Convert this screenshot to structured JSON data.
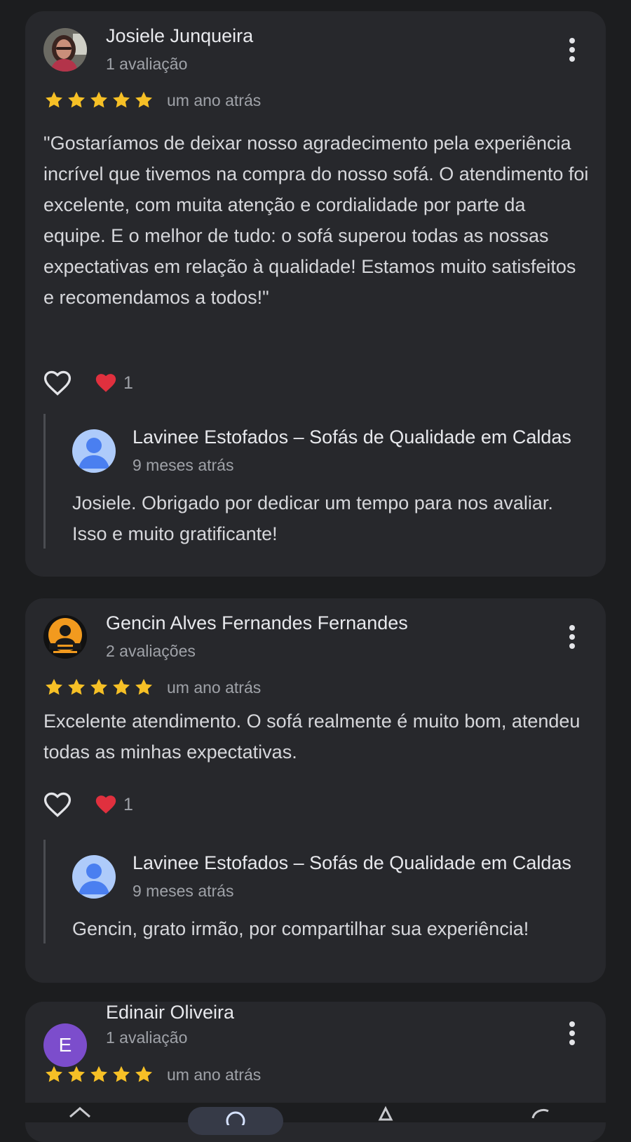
{
  "reviews": [
    {
      "author": "Josiele Junqueira",
      "author_meta": "1 avaliação",
      "rating": 5,
      "time": "um ano atrás",
      "text": "\"Gostaríamos de deixar nosso agradecimento pela experiência incrível que tivemos na compra do nosso sofá. O atendimento foi excelente, com muita atenção e cordialidade por parte da equipe. E o melhor de tudo: o sofá superou todas as nossas expectativas em relação à qualidade! Estamos muito satisfeitos e recomendamos a todos!\"",
      "reactions": "1",
      "reply": {
        "name": "Lavinee Estofados – Sofás de Qualidade em Caldas",
        "time": "9 meses atrás",
        "text": "Josiele. Obrigado por dedicar um tempo para nos avaliar. Isso e muito gratificante!"
      }
    },
    {
      "author": "Gencin Alves Fernandes Fernandes",
      "author_meta": "2 avaliações",
      "rating": 5,
      "time": "um ano atrás",
      "text": "Excelente atendimento. O sofá realmente é muito bom, atendeu todas as minhas expectativas.",
      "reactions": "1",
      "reply": {
        "name": "Lavinee Estofados – Sofás de Qualidade em Caldas",
        "time": "9 meses atrás",
        "text": "Gencin, grato irmão, por compartilhar sua experiência!"
      }
    },
    {
      "author": "Edinair Oliveira",
      "author_meta": "1 avaliação",
      "avatar_letter": "E",
      "rating": 5,
      "time": "um ano atrás"
    }
  ],
  "colors": {
    "background": "#1c1d1f",
    "card": "#27282c",
    "star": "#f6c026",
    "heart_badge": "#e0303e",
    "avatar_letter_bg": "#7c4dcc",
    "default_avatar_bg": "#aecbfa"
  },
  "icons": {
    "menu": "more-vert-icon",
    "like": "heart-outline-icon",
    "reaction": "heart-filled-icon",
    "default_avatar": "person-icon"
  }
}
